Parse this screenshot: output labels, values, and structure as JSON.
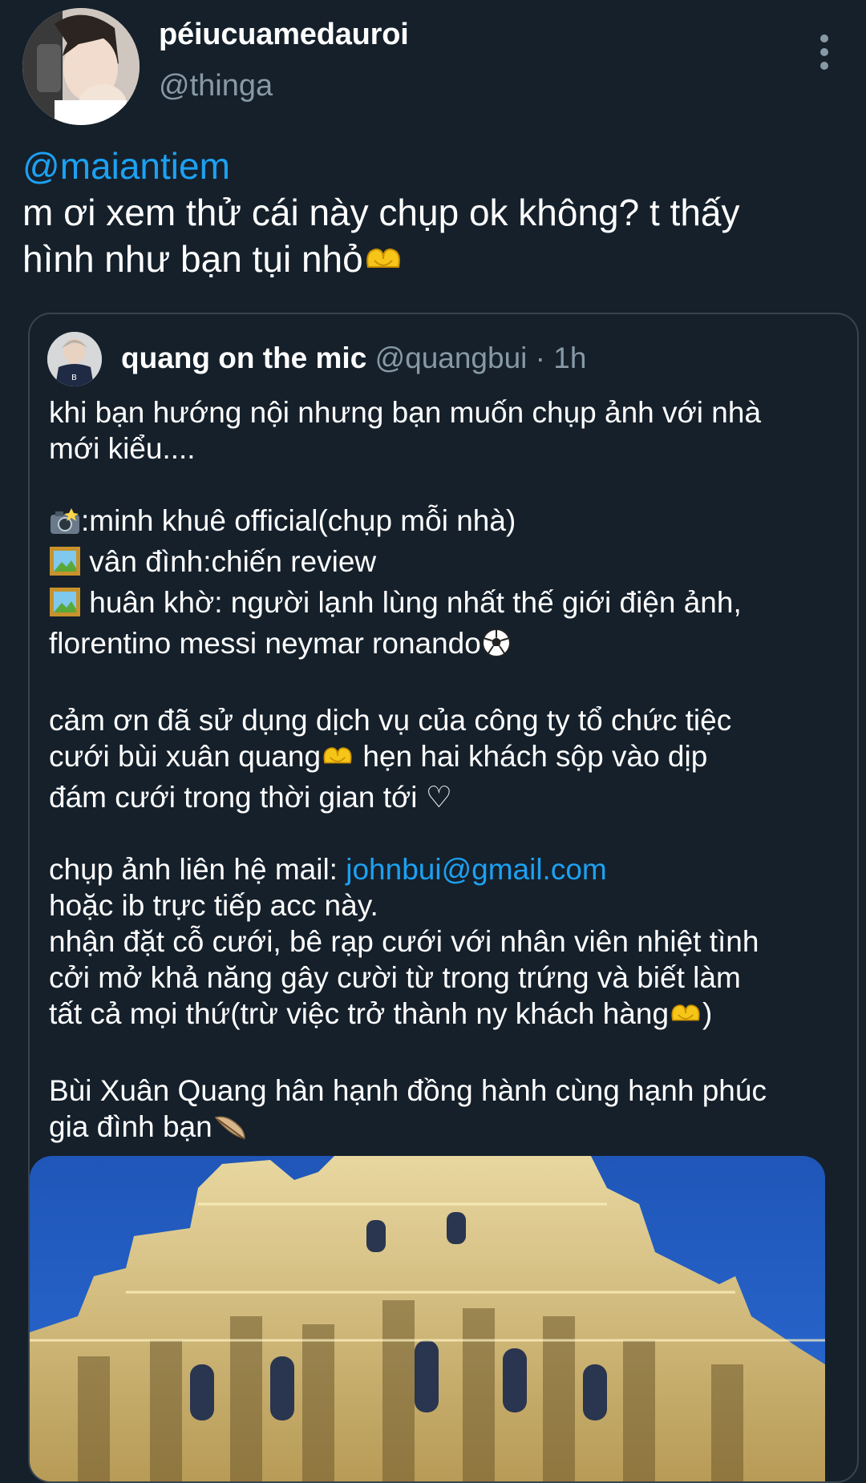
{
  "tweet": {
    "display_name": "péiucuamedauroi",
    "handle": "@thinga",
    "mention": "@maiantiem",
    "text_lines": [
      "m ơi xem thử cái này chụp ok không? t thấy",
      "hình như bạn tụi nhỏ"
    ]
  },
  "quoted_tweet": {
    "display_name": "quang on the mic",
    "handle": "@quangbui",
    "separator": "·",
    "time": "1h",
    "p1": [
      "khi bạn hướng nội nhưng bạn muốn chụp ảnh với nhà",
      "mới kiểu...."
    ],
    "p2": [
      ":minh khuê official(chụp mỗi nhà)",
      " vân đình:chiến review",
      " huân khờ: người lạnh lùng nhất thế giới điện ảnh,",
      "florentino messi neymar ronando"
    ],
    "p3": [
      "cảm ơn đã sử dụng dịch vụ của công ty tổ chức tiệc",
      "cưới bùi xuân quang",
      " hẹn hai khách sộp vào dịp",
      "đám cưới trong thời gian tới ♡"
    ],
    "p4": {
      "contact_label": "chụp ảnh liên hệ mail: ",
      "email": "johnbui@gmail.com",
      "lines": [
        "hoặc ib trực tiếp acc này.",
        "nhận đặt cỗ cưới, bê rạp cưới với nhân viên nhiệt tình",
        "cởi mở khả năng gây cười từ trong trứng và biết làm",
        "tất cả mọi thứ(trừ việc trở thành ny khách hàng",
        ")"
      ]
    },
    "p5": [
      "Bùi Xuân Quang hân hạnh đồng hành cùng hạnh phúc",
      "gia đình bạn"
    ]
  },
  "icons": {
    "heart_hands": "heart-hands-icon",
    "camera_flash": "camera-flash-icon",
    "framed_picture": "framed-picture-icon",
    "soccer_ball": "soccer-ball-icon",
    "feather": "feather-icon",
    "more": "more-vertical-icon"
  },
  "colors": {
    "background": "#15202b",
    "accent": "#1da1f2",
    "secondary_text": "#8899a6",
    "card_border": "#38444d"
  }
}
